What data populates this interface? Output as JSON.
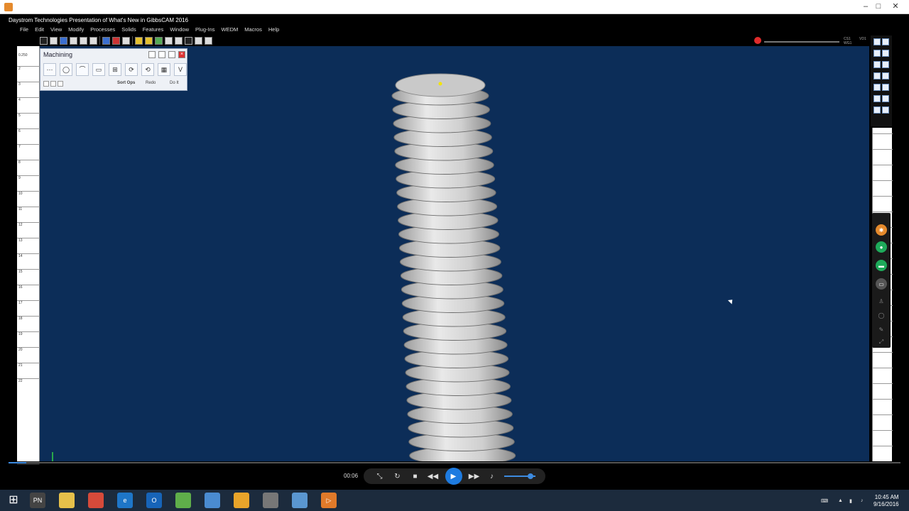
{
  "window": {
    "min_label": "–",
    "max_label": "□",
    "close_label": "✕"
  },
  "app": {
    "title": "Daystrom Technologies Presentation of What's New in GibbsCAM 2016"
  },
  "menu": [
    "File",
    "Edit",
    "View",
    "Modify",
    "Processes",
    "Solids",
    "Features",
    "Window",
    "Plug-Ins",
    "WEDM",
    "Macros",
    "Help"
  ],
  "machining": {
    "title": "Machining",
    "sort_label": "Sort Ops",
    "redo_label": "Redo",
    "doit_label": "Do It",
    "tools": [
      "⋯",
      "◯",
      "⌒",
      "▭",
      "⊞",
      "⟳",
      "⟲",
      "▦",
      "V"
    ]
  },
  "ruler_left": {
    "top_value": "0.250",
    "labels": [
      "2",
      "3",
      "4",
      "5",
      "6",
      "7",
      "8",
      "9",
      "10",
      "11",
      "12",
      "13",
      "14",
      "15",
      "16",
      "17",
      "18",
      "19",
      "20",
      "21",
      "22"
    ]
  },
  "status": {
    "cs_label": "CS1",
    "wg_label": "WG1",
    "v_label": "VD1"
  },
  "player": {
    "time": "00:06",
    "progress_fraction": 0.02,
    "volume_fraction": 0.85
  },
  "taskbar": {
    "time": "10:45 AM",
    "date": "9/16/2016",
    "apps": [
      {
        "name": "pn-icon",
        "label": "PN",
        "color": "#444"
      },
      {
        "name": "folder-icon",
        "label": "",
        "color": "#e6c04a"
      },
      {
        "name": "chrome-icon",
        "label": "",
        "color": "#d64a3a"
      },
      {
        "name": "ie-icon",
        "label": "e",
        "color": "#1e76c8"
      },
      {
        "name": "outlook-icon",
        "label": "O",
        "color": "#1764b8"
      },
      {
        "name": "gibbscam-icon",
        "label": "",
        "color": "#5fae4a"
      },
      {
        "name": "calculator-icon",
        "label": "",
        "color": "#4a8bd0"
      },
      {
        "name": "rhino-icon",
        "label": "",
        "color": "#e8a42a"
      },
      {
        "name": "vectorworks-icon",
        "label": "",
        "color": "#777"
      },
      {
        "name": "mirror-icon",
        "label": "",
        "color": "#5a96d0"
      },
      {
        "name": "recorder-icon",
        "label": "▷",
        "color": "#e07a2a"
      }
    ]
  },
  "colors": {
    "viewport": "#0c2d58",
    "accent": "#1e7be0",
    "taskbar": "#1c2b3d"
  }
}
